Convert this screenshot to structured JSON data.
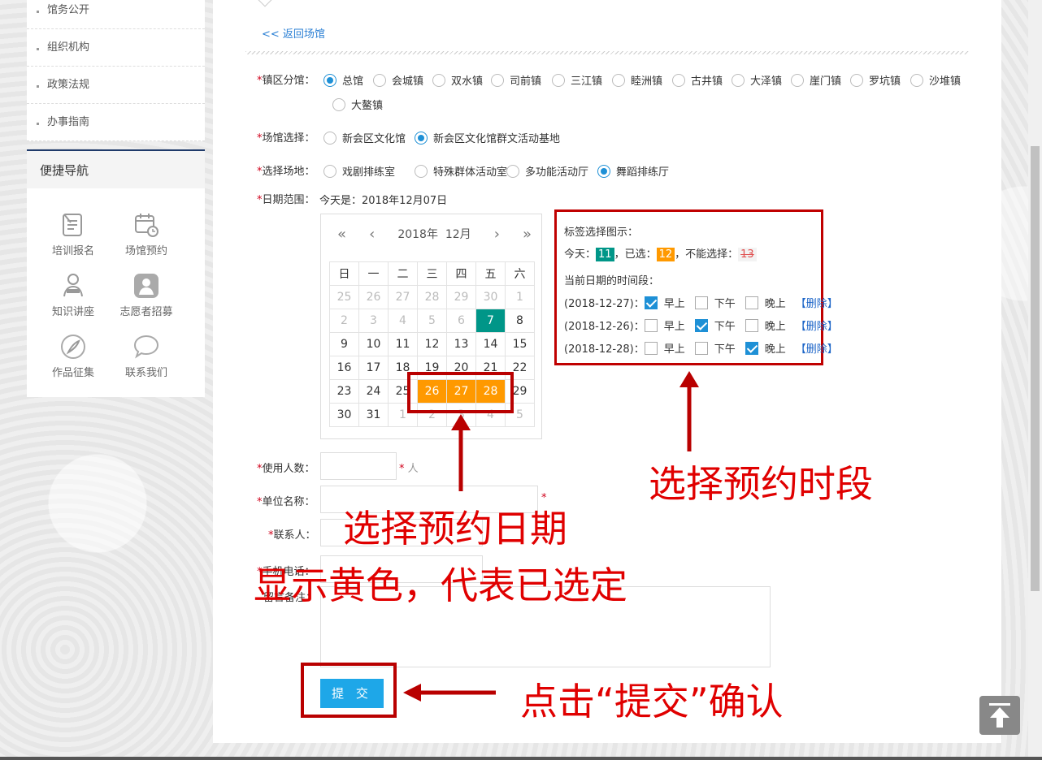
{
  "sidebar": {
    "items": [
      {
        "label": "馆务公开"
      },
      {
        "label": "组织机构"
      },
      {
        "label": "政策法规"
      },
      {
        "label": "办事指南"
      }
    ]
  },
  "quick_nav": {
    "title": "便捷导航",
    "items": [
      {
        "label": "培训报名",
        "icon": "signup-icon"
      },
      {
        "label": "场馆预约",
        "icon": "calendar-clock-icon"
      },
      {
        "label": "知识讲座",
        "icon": "lecture-icon"
      },
      {
        "label": "志愿者招募",
        "icon": "volunteer-icon"
      },
      {
        "label": "作品征集",
        "icon": "feather-icon"
      },
      {
        "label": "联系我们",
        "icon": "chat-bubble-icon"
      }
    ]
  },
  "back_link": "<< 返回场馆",
  "form": {
    "district_label": "镇区分馆：",
    "districts": [
      "总馆",
      "会城镇",
      "双水镇",
      "司前镇",
      "三江镇",
      "睦洲镇",
      "古井镇",
      "大泽镇",
      "崖门镇",
      "罗坑镇",
      "沙堆镇",
      "大鳌镇"
    ],
    "district_selected": "总馆",
    "venue_label": "场馆选择：",
    "venues": [
      "新会区文化馆",
      "新会区文化馆群文活动基地"
    ],
    "venue_selected": "新会区文化馆群文活动基地",
    "room_label": "选择场地：",
    "rooms": [
      "戏剧排练室",
      "特殊群体活动室",
      "多功能活动厅",
      "舞蹈排练厅"
    ],
    "room_selected": "舞蹈排练厅",
    "date_label": "日期范围：",
    "today_text": "今天是：2018年12月07日",
    "people_label": "使用人数：",
    "people_unit": "人",
    "unit_label": "单位名称：",
    "contact_label": "联系人：",
    "phone_label": "手机电话：",
    "remark_label": "留言备注：",
    "submit": "提 交"
  },
  "calendar": {
    "year": "2018年",
    "month": "12月",
    "prev_year": "«",
    "prev_month": "‹",
    "next_month": "›",
    "next_year": "»",
    "weekdays": [
      "日",
      "一",
      "二",
      "三",
      "四",
      "五",
      "六"
    ],
    "weeks": [
      [
        {
          "d": "25",
          "s": "other"
        },
        {
          "d": "26",
          "s": "other"
        },
        {
          "d": "27",
          "s": "other"
        },
        {
          "d": "28",
          "s": "other"
        },
        {
          "d": "29",
          "s": "other"
        },
        {
          "d": "30",
          "s": "other"
        },
        {
          "d": "1",
          "s": "other"
        }
      ],
      [
        {
          "d": "2",
          "s": "other"
        },
        {
          "d": "3",
          "s": "other"
        },
        {
          "d": "4",
          "s": "other"
        },
        {
          "d": "5",
          "s": "other"
        },
        {
          "d": "6",
          "s": "other"
        },
        {
          "d": "7",
          "s": "today"
        },
        {
          "d": "8",
          "s": ""
        }
      ],
      [
        {
          "d": "9",
          "s": ""
        },
        {
          "d": "10",
          "s": ""
        },
        {
          "d": "11",
          "s": ""
        },
        {
          "d": "12",
          "s": ""
        },
        {
          "d": "13",
          "s": ""
        },
        {
          "d": "14",
          "s": ""
        },
        {
          "d": "15",
          "s": ""
        }
      ],
      [
        {
          "d": "16",
          "s": ""
        },
        {
          "d": "17",
          "s": ""
        },
        {
          "d": "18",
          "s": ""
        },
        {
          "d": "19",
          "s": ""
        },
        {
          "d": "20",
          "s": ""
        },
        {
          "d": "21",
          "s": ""
        },
        {
          "d": "22",
          "s": ""
        }
      ],
      [
        {
          "d": "23",
          "s": ""
        },
        {
          "d": "24",
          "s": ""
        },
        {
          "d": "25",
          "s": ""
        },
        {
          "d": "26",
          "s": "sel"
        },
        {
          "d": "27",
          "s": "sel"
        },
        {
          "d": "28",
          "s": "sel"
        },
        {
          "d": "29",
          "s": ""
        }
      ],
      [
        {
          "d": "30",
          "s": ""
        },
        {
          "d": "31",
          "s": ""
        },
        {
          "d": "1",
          "s": "other"
        },
        {
          "d": "2",
          "s": "other"
        },
        {
          "d": "3",
          "s": "other"
        },
        {
          "d": "4",
          "s": "other"
        },
        {
          "d": "5",
          "s": "other"
        }
      ]
    ]
  },
  "legend": {
    "title": "标签选择图示：",
    "today_prefix": "今天：",
    "today_chip": "11",
    "selected_prefix": "，已选：",
    "selected_chip": "12",
    "disabled_prefix": "，不能选择：",
    "disabled_chip": "13",
    "periods_title": "当前日期的时间段：",
    "slot_names": [
      "早上",
      "下午",
      "晚上"
    ],
    "delete_label": "【删除】",
    "rows": [
      {
        "date": "(2018-12-27)：",
        "checked": [
          true,
          false,
          false
        ]
      },
      {
        "date": "(2018-12-26)：",
        "checked": [
          false,
          true,
          false
        ]
      },
      {
        "date": "(2018-12-28)：",
        "checked": [
          false,
          false,
          true
        ]
      }
    ]
  },
  "annotations": {
    "pick_time": "选择预约时段",
    "pick_date": "选择预约日期",
    "yellow_note": "显示黄色，代表已选定",
    "click_submit": "点击“提交”确认"
  },
  "colors": {
    "accent": "#1ea7e8",
    "today": "#009688",
    "selected": "#ff9900",
    "annotation": "#e00000",
    "annotation_box": "#b90000"
  }
}
